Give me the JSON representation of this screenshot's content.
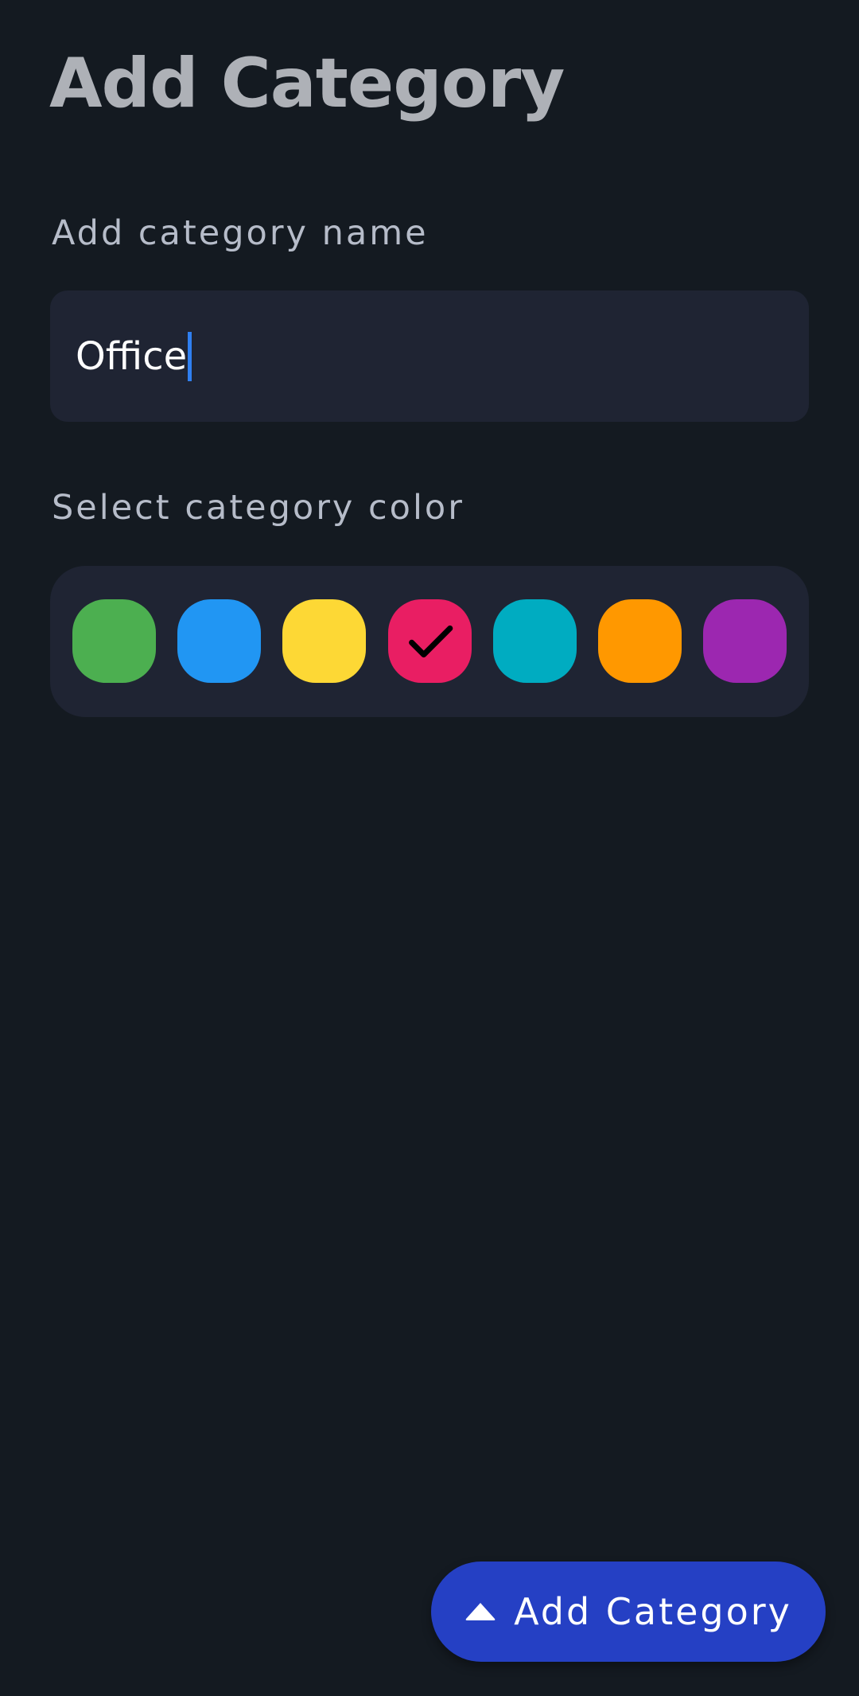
{
  "header": {
    "title": "Add Category"
  },
  "name_section": {
    "label": "Add category name",
    "value": "Office"
  },
  "color_section": {
    "label": "Select category color",
    "selected_index": 3,
    "colors": [
      "#4caf50",
      "#2196f3",
      "#fdd835",
      "#e91e63",
      "#00acc1",
      "#ff9800",
      "#9c27b0"
    ]
  },
  "footer": {
    "add_button_label": "Add Category",
    "add_button_icon": "arrow-up-icon",
    "accent": "#2540c4"
  },
  "theme": {
    "background": "#141a21",
    "surface": "#1f2433",
    "caret": "#2f7ff0"
  }
}
